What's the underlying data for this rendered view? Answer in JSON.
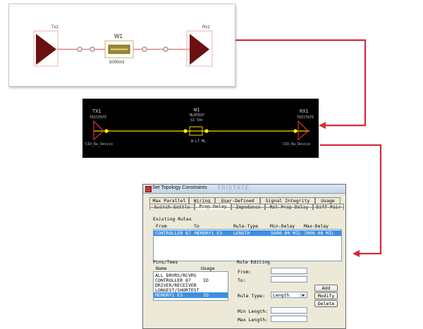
{
  "schematic_white": {
    "tx_label": "Tx1",
    "rx_label": "Rx1",
    "wire_label": "W1",
    "wire_length": "5000mil",
    "colors": {
      "driver": "#6b0f10",
      "wire": "#e06a6a",
      "node": "#a0a0a0",
      "component": "#8b7a2a"
    }
  },
  "schematic_black": {
    "tx_label": "TX1",
    "tx_sub": "TRISTATE",
    "tx_bottom": "CIO_Ra_Device",
    "rx_label": "RX1",
    "rx_sub": "TRISTATE",
    "rx_bottom": "CIO_Ra_Device",
    "wire_label": "W1",
    "wire_type": "MLNTRIP",
    "wire_sub": "SI 50n",
    "wire_bottom": "W.LT ML",
    "colors": {
      "background": "#000000",
      "line": "#ffd400",
      "driver": "#ff4040",
      "node": "#ffff00"
    }
  },
  "arrow_color": "#d42a3c",
  "dialog": {
    "title": "Set Topology Constraints",
    "watermark": "TRISTATE",
    "tabs_row1": [
      "Max Parallel",
      "Wiring",
      "User-Defined",
      "Signal Integrity",
      "Usage"
    ],
    "tabs_row2": [
      "Switch-Settle",
      "Prop Delay",
      "Impedance",
      "Rel Prop Delay",
      "Diff Pair"
    ],
    "active_tab": "Prop Delay",
    "existing_rules": {
      "label": "Existing Rules",
      "headers": [
        "From",
        "To",
        "Rule-Type",
        "Min-Delay",
        "Max-Delay"
      ],
      "rows": [
        {
          "from": "CONTROLLER 87",
          "to": "MEMORY1 E3",
          "type": "LENGTH",
          "min": "5000.00 MIL",
          "max": "7000.00 MIL"
        }
      ]
    },
    "pins_tees": {
      "label": "Pins/Tees",
      "headers": [
        "Name",
        "Usage"
      ],
      "rows": [
        {
          "name": "ALL DRVRS/RCVRS",
          "usage": ""
        },
        {
          "name": "CONTROLLER 87",
          "usage": "IO"
        },
        {
          "name": "DRIVER/RECEIVER",
          "usage": ""
        },
        {
          "name": "LONGEST/SHORTEST",
          "usage": ""
        },
        {
          "name": "MEMORY1 E3",
          "usage": "IO"
        }
      ],
      "selected_index": 4
    },
    "rule_editing": {
      "label": "Rule Editing",
      "from_label": "From:",
      "to_label": "To:",
      "rule_type_label": "Rule Type:",
      "rule_type_value": "Length",
      "min_length_label": "Min Length:",
      "max_length_label": "Max Length:",
      "add_label": "Add",
      "modify_label": "Modify",
      "delete_label": "Delete"
    }
  }
}
